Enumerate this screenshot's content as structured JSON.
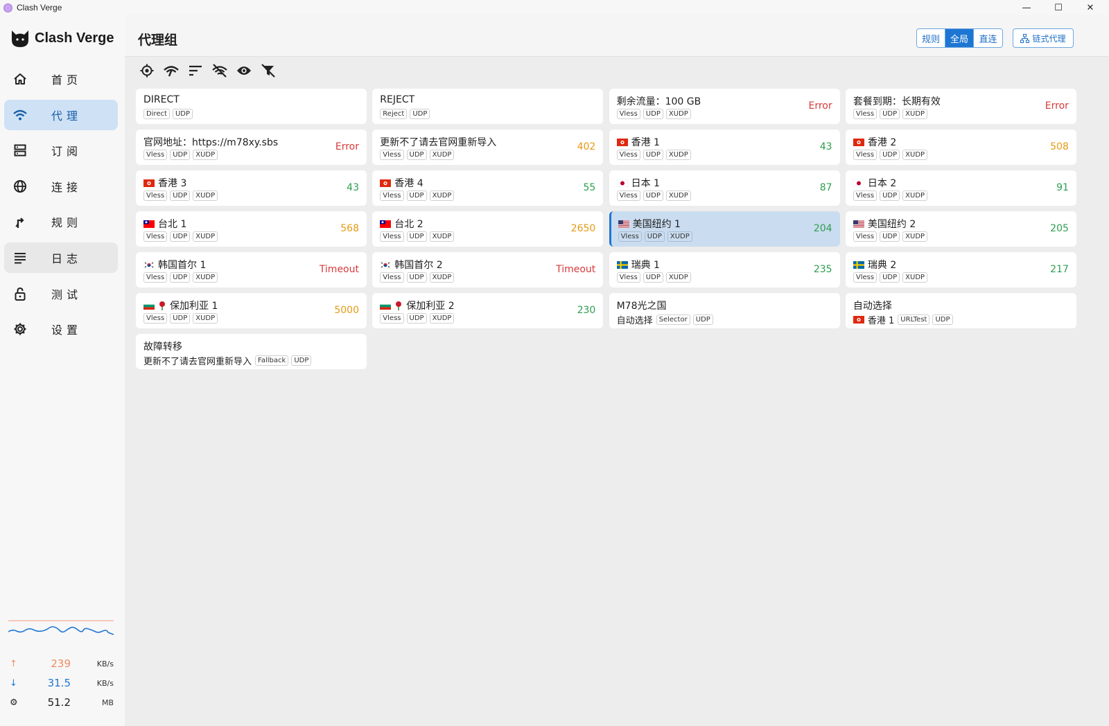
{
  "window": {
    "title": "Clash Verge",
    "controls": {
      "minimize": "—",
      "maximize": "☐",
      "close": "✕"
    }
  },
  "sidebar": {
    "logo_text": "Clash Verge",
    "items": [
      {
        "label": "首页",
        "icon": "home-icon"
      },
      {
        "label": "代理",
        "icon": "wifi-icon",
        "active": true
      },
      {
        "label": "订阅",
        "icon": "server-icon"
      },
      {
        "label": "连接",
        "icon": "globe-icon"
      },
      {
        "label": "规则",
        "icon": "route-icon"
      },
      {
        "label": "日志",
        "icon": "list-icon",
        "hover": true
      },
      {
        "label": "测试",
        "icon": "lock-icon"
      },
      {
        "label": "设置",
        "icon": "gear-icon"
      }
    ],
    "stats": {
      "upload": {
        "value": "239",
        "unit": "KB/s",
        "color": "#f08b62"
      },
      "download": {
        "value": "31.5",
        "unit": "KB/s",
        "color": "#1e76d3"
      },
      "memory": {
        "value": "51.2",
        "unit": "MB"
      }
    }
  },
  "header": {
    "title": "代理组",
    "modes": [
      "规则",
      "全局",
      "直连"
    ],
    "active_mode": "全局",
    "chain_button": "链式代理"
  },
  "toolbar": [
    "locate-icon",
    "speed-test-icon",
    "sort-icon",
    "hide-unavailable-icon",
    "eye-icon",
    "filter-off-icon"
  ],
  "colors": {
    "error": "#d9393a",
    "warn": "#e69a12",
    "ok": "#2e9e4f",
    "accent": "#1e76d3",
    "selected_bg": "#cadcef"
  },
  "proxies": [
    {
      "name": "DIRECT",
      "tags": [
        "Direct",
        "UDP"
      ],
      "delay": ""
    },
    {
      "name": "REJECT",
      "tags": [
        "Reject",
        "UDP"
      ],
      "delay": ""
    },
    {
      "name": "剩余流量：100 GB",
      "tags": [
        "Vless",
        "UDP",
        "XUDP"
      ],
      "delay": "Error",
      "status": "error"
    },
    {
      "name": "套餐到期：长期有效",
      "tags": [
        "Vless",
        "UDP",
        "XUDP"
      ],
      "delay": "Error",
      "status": "error"
    },
    {
      "name": "官网地址：https://m78xy.sbs",
      "tags": [
        "Vless",
        "UDP",
        "XUDP"
      ],
      "delay": "Error",
      "status": "error"
    },
    {
      "name": "更新不了请去官网重新导入",
      "tags": [
        "Vless",
        "UDP",
        "XUDP"
      ],
      "delay": "402",
      "status": "warn"
    },
    {
      "name": "香港 1",
      "flag": "hk",
      "tags": [
        "Vless",
        "UDP",
        "XUDP"
      ],
      "delay": "43",
      "status": "ok"
    },
    {
      "name": "香港 2",
      "flag": "hk",
      "tags": [
        "Vless",
        "UDP",
        "XUDP"
      ],
      "delay": "508",
      "status": "warn"
    },
    {
      "name": "香港 3",
      "flag": "hk",
      "tags": [
        "Vless",
        "UDP",
        "XUDP"
      ],
      "delay": "43",
      "status": "ok"
    },
    {
      "name": "香港 4",
      "flag": "hk",
      "tags": [
        "Vless",
        "UDP",
        "XUDP"
      ],
      "delay": "55",
      "status": "ok"
    },
    {
      "name": "日本 1",
      "flag": "jp",
      "tags": [
        "Vless",
        "UDP",
        "XUDP"
      ],
      "delay": "87",
      "status": "ok"
    },
    {
      "name": "日本 2",
      "flag": "jp",
      "tags": [
        "Vless",
        "UDP",
        "XUDP"
      ],
      "delay": "91",
      "status": "ok"
    },
    {
      "name": "台北 1",
      "flag": "tw",
      "tags": [
        "Vless",
        "UDP",
        "XUDP"
      ],
      "delay": "568",
      "status": "warn"
    },
    {
      "name": "台北 2",
      "flag": "tw",
      "tags": [
        "Vless",
        "UDP",
        "XUDP"
      ],
      "delay": "2650",
      "status": "warn"
    },
    {
      "name": "美国纽约 1",
      "flag": "us",
      "tags": [
        "Vless",
        "UDP",
        "XUDP"
      ],
      "delay": "204",
      "status": "ok",
      "selected": true
    },
    {
      "name": "美国纽约 2",
      "flag": "us",
      "tags": [
        "Vless",
        "UDP",
        "XUDP"
      ],
      "delay": "205",
      "status": "ok"
    },
    {
      "name": "韩国首尔 1",
      "flag": "kr",
      "tags": [
        "Vless",
        "UDP",
        "XUDP"
      ],
      "delay": "Timeout",
      "status": "error"
    },
    {
      "name": "韩国首尔 2",
      "flag": "kr",
      "tags": [
        "Vless",
        "UDP",
        "XUDP"
      ],
      "delay": "Timeout",
      "status": "error"
    },
    {
      "name": "瑞典 1",
      "flag": "se",
      "tags": [
        "Vless",
        "UDP",
        "XUDP"
      ],
      "delay": "235",
      "status": "ok"
    },
    {
      "name": "瑞典 2",
      "flag": "se",
      "tags": [
        "Vless",
        "UDP",
        "XUDP"
      ],
      "delay": "217",
      "status": "ok"
    },
    {
      "name": "保加利亚 1",
      "flag": "bg",
      "tags": [
        "Vless",
        "UDP",
        "XUDP"
      ],
      "delay": "5000",
      "status": "warn"
    },
    {
      "name": "保加利亚 2",
      "flag": "bg",
      "tags": [
        "Vless",
        "UDP",
        "XUDP"
      ],
      "delay": "230",
      "status": "ok"
    },
    {
      "name": "M78光之国",
      "sub": "自动选择",
      "tags": [
        "Selector",
        "UDP"
      ],
      "delay": ""
    },
    {
      "name": "自动选择",
      "sub": "香港 1",
      "subflag": "hk",
      "tags": [
        "URLTest",
        "UDP"
      ],
      "delay": ""
    },
    {
      "name": "故障转移",
      "sub": "更新不了请去官网重新导入",
      "tags": [
        "Fallback",
        "UDP"
      ],
      "delay": ""
    }
  ]
}
